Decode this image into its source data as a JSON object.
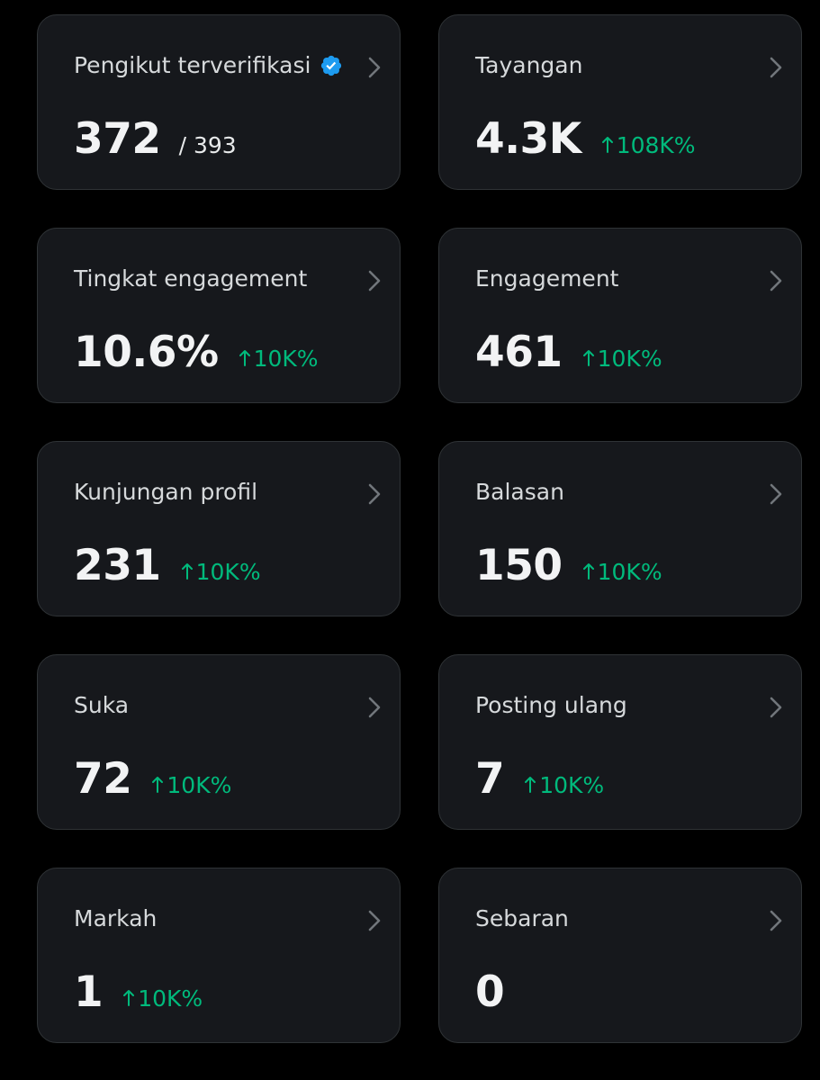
{
  "theme": {
    "background": "#000000",
    "card_background": "#16181c",
    "card_border": "#2f3336",
    "label_color": "#d6d9db",
    "value_color": "#f2f3f4",
    "positive_color": "#00ba7c",
    "verified_color": "#1d9bf0"
  },
  "cards": [
    {
      "id": "verified-followers",
      "label": "Pengikut terverifikasi",
      "value": "372",
      "total": "/ 393",
      "verified_icon": "verified-badge-icon"
    },
    {
      "id": "impressions",
      "label": "Tayangan",
      "value": "4.3K",
      "delta": "108K%",
      "delta_icon": "arrow-up-icon"
    },
    {
      "id": "engagement-rate",
      "label": "Tingkat engagement",
      "value": "10.6%",
      "delta": "10K%",
      "delta_icon": "arrow-up-icon"
    },
    {
      "id": "engagements",
      "label": "Engagement",
      "value": "461",
      "delta": "10K%",
      "delta_icon": "arrow-up-icon"
    },
    {
      "id": "profile-visits",
      "label": "Kunjungan profil",
      "value": "231",
      "delta": "10K%",
      "delta_icon": "arrow-up-icon"
    },
    {
      "id": "replies",
      "label": "Balasan",
      "value": "150",
      "delta": "10K%",
      "delta_icon": "arrow-up-icon"
    },
    {
      "id": "likes",
      "label": "Suka",
      "value": "72",
      "delta": "10K%",
      "delta_icon": "arrow-up-icon"
    },
    {
      "id": "reposts",
      "label": "Posting ulang",
      "value": "7",
      "delta": "10K%",
      "delta_icon": "arrow-up-icon"
    },
    {
      "id": "bookmarks",
      "label": "Markah",
      "value": "1",
      "delta": "10K%",
      "delta_icon": "arrow-up-icon"
    },
    {
      "id": "shares",
      "label": "Sebaran",
      "value": "0"
    }
  ],
  "chevron_icon": "chevron-right-icon"
}
